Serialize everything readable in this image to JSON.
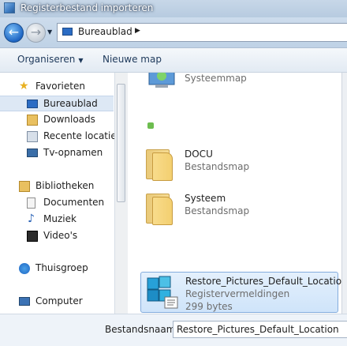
{
  "window": {
    "title": "Registerbestand importeren"
  },
  "address": {
    "location": "Bureaublad"
  },
  "toolbar": {
    "organize_label": "Organiseren",
    "new_folder_label": "Nieuwe map"
  },
  "sidebar": {
    "groups": [
      {
        "label": "Favorieten",
        "icon": "star-icon",
        "items": [
          {
            "label": "Bureaublad",
            "icon": "desktop-icon",
            "selected": true
          },
          {
            "label": "Downloads",
            "icon": "downloads-icon"
          },
          {
            "label": "Recente locaties",
            "icon": "recent-places-icon"
          },
          {
            "label": "Tv-opnamen",
            "icon": "tv-recordings-icon"
          }
        ]
      },
      {
        "label": "Bibliotheken",
        "icon": "libraries-icon",
        "items": [
          {
            "label": "Documenten",
            "icon": "documents-icon"
          },
          {
            "label": "Muziek",
            "icon": "music-icon"
          },
          {
            "label": "Video's",
            "icon": "videos-icon"
          }
        ]
      },
      {
        "label": "Thuisgroep",
        "icon": "homegroup-icon",
        "items": []
      },
      {
        "label": "Computer",
        "icon": "computer-icon",
        "items": []
      }
    ]
  },
  "files": [
    {
      "name": "",
      "type": "Systeemmap",
      "icon": "control-panel-icon"
    },
    {
      "name": "DOCU",
      "type": "Bestandsmap",
      "icon": "folder-icon"
    },
    {
      "name": "Systeem",
      "type": "Bestandsmap",
      "icon": "folder-icon"
    },
    {
      "name": "Restore_Pictures_Default_Location",
      "type": "Registervermeldingen",
      "size": "299 bytes",
      "icon": "registry-file-icon",
      "selected": true
    }
  ],
  "footer": {
    "filename_label": "Bestandsnaam:",
    "filename_value": "Restore_Pictures_Default_Location"
  },
  "colors": {
    "selection": "#cfe4fa",
    "selection_border": "#84acdd",
    "accent": "#1f66c4"
  }
}
